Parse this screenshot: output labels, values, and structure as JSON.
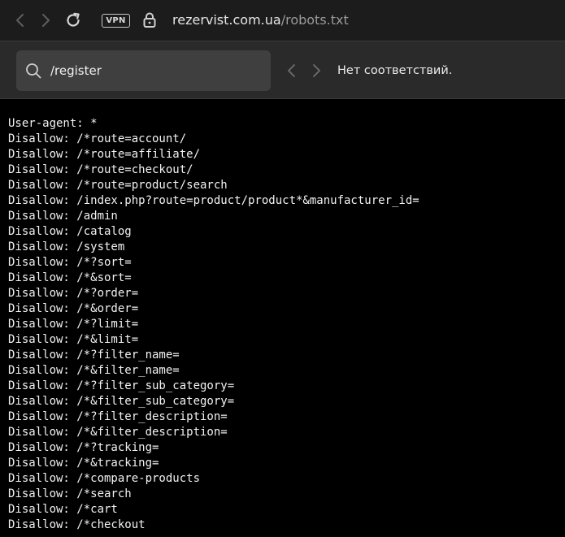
{
  "browser": {
    "vpn_label": "VPN",
    "url_domain": "rezervist.com.ua",
    "url_path": "/robots.txt",
    "icons": {
      "back": "chevron-left-icon",
      "forward": "chevron-right-icon",
      "reload": "reload-icon",
      "lock": "lock-icon"
    }
  },
  "find_bar": {
    "query": "/register",
    "status": "Нет соответствий.",
    "icons": {
      "search": "search-icon",
      "prev": "chevron-left-icon",
      "next": "chevron-right-icon"
    }
  },
  "content": {
    "lines": [
      "User-agent: *",
      "Disallow: /*route=account/",
      "Disallow: /*route=affiliate/",
      "Disallow: /*route=checkout/",
      "Disallow: /*route=product/search",
      "Disallow: /index.php?route=product/product*&manufacturer_id=",
      "Disallow: /admin",
      "Disallow: /catalog",
      "Disallow: /system",
      "Disallow: /*?sort=",
      "Disallow: /*&sort=",
      "Disallow: /*?order=",
      "Disallow: /*&order=",
      "Disallow: /*?limit=",
      "Disallow: /*&limit=",
      "Disallow: /*?filter_name=",
      "Disallow: /*&filter_name=",
      "Disallow: /*?filter_sub_category=",
      "Disallow: /*&filter_sub_category=",
      "Disallow: /*?filter_description=",
      "Disallow: /*&filter_description=",
      "Disallow: /*?tracking=",
      "Disallow: /*&tracking=",
      "Disallow: /*compare-products",
      "Disallow: /*search",
      "Disallow: /*cart",
      "Disallow: /*checkout"
    ]
  },
  "colors": {
    "background": "#000000",
    "text": "#f2f2f2",
    "toolbar": "#1c1c1c",
    "find_bar": "#2a2a2a",
    "find_input": "#3f3f3f"
  }
}
